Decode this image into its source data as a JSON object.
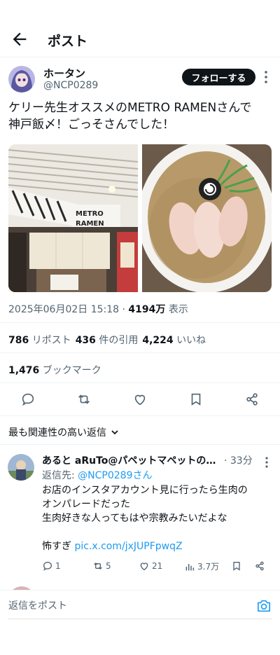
{
  "header": {
    "title": "ポスト"
  },
  "author": {
    "name": "ホータン",
    "handle": "@NCP0289",
    "follow_label": "フォローする"
  },
  "post": {
    "text_line1": "ケリー先生オススメのMETRO RAMENさんで",
    "text_line2": "神戸飯〆！ごっそさんでした！",
    "timestamp": "2025年06月02日 15:18",
    "views_count": "4194万",
    "views_label": "表示",
    "media": {
      "left_sign_text": "METRO RAMEN"
    }
  },
  "stats": {
    "reposts_count": "786",
    "reposts_label": "リポスト",
    "quotes_count": "436",
    "quotes_label": "件の引用",
    "likes_count": "4,224",
    "likes_label": "いいね",
    "bookmarks_count": "1,476",
    "bookmarks_label": "ブックマーク"
  },
  "replies_sort_label": "最も関連性の高い返信",
  "reply": {
    "name": "あると aRuTo@パペットマペットの…",
    "time": "· 33分",
    "replying_to_prefix": "返信先: ",
    "replying_to_handle": "@NCP0289さん",
    "line1": "お店のインスタアカウント見に行ったら生肉の",
    "line2": "オンパレードだった",
    "line3": "生肉好きな人ってもはや宗教みたいだよな",
    "line4_prefix": "怖すぎ ",
    "line4_link": "pic.x.com/jxJUPFpwqZ",
    "replies_count": "1",
    "reposts_count": "5",
    "likes_count": "21",
    "views_count": "3.7万"
  },
  "compose": {
    "placeholder": "返信をポスト"
  },
  "icons": {
    "back": "arrow-left-icon",
    "more": "more-vertical-icon",
    "reply": "reply-icon",
    "repost": "repost-icon",
    "like": "heart-icon",
    "bookmark": "bookmark-icon",
    "share": "share-icon",
    "views": "bar-chart-icon",
    "camera": "camera-icon",
    "chevron": "chevron-down-icon"
  },
  "colors": {
    "link": "#1d9bf0",
    "text": "#0f1419",
    "muted": "#536471"
  }
}
